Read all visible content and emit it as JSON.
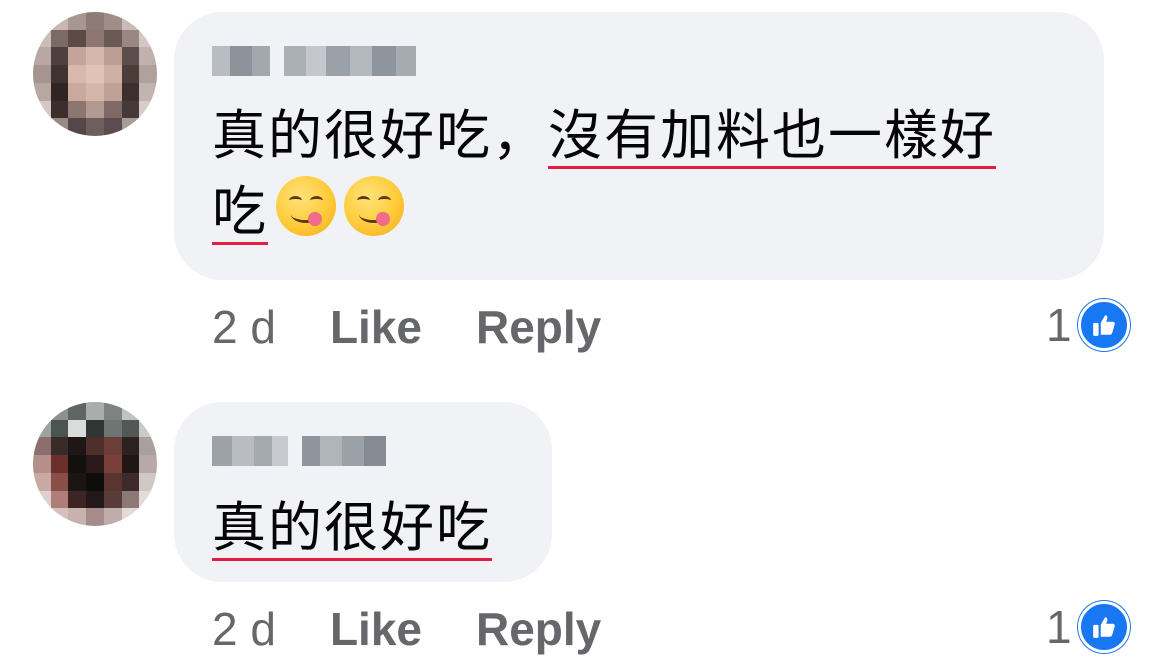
{
  "comments": [
    {
      "text_line1_plain": "真的很好吃，",
      "text_line1_underlined": "沒有加料也一樣好",
      "text_line2_underlined": "吃",
      "emojis": [
        "😋",
        "😋"
      ],
      "time": "2 d",
      "like_label": "Like",
      "reply_label": "Reply",
      "reaction_count": "1"
    },
    {
      "text_line1_underlined": "真的很好吃",
      "time": "2 d",
      "like_label": "Like",
      "reply_label": "Reply",
      "reaction_count": "1"
    }
  ],
  "icons": {
    "reaction": "thumbs-up-icon",
    "emoji": "face-savoring-food-icon"
  },
  "colors": {
    "bubble": "#f0f2f5",
    "meta_text": "#65676b",
    "underline": "#e41e3f",
    "like_blue": "#1877f2"
  }
}
